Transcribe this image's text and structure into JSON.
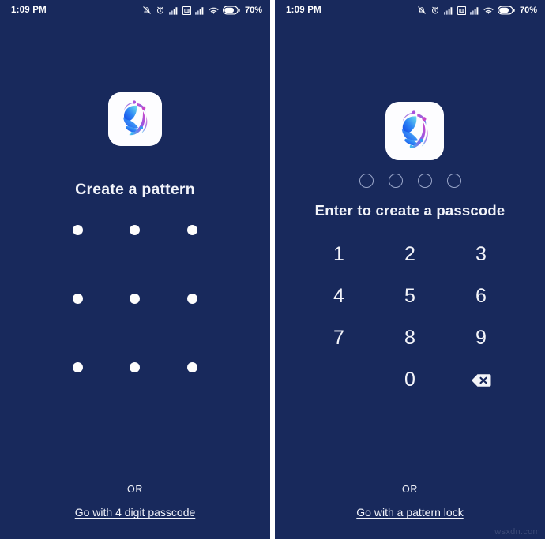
{
  "meta": {
    "watermark": "wsxdn.com",
    "background_color": "#18295c",
    "text_color": "#f2f4fa",
    "dot_color": "#fdfdfd"
  },
  "statusbar": {
    "time": "1:09 PM",
    "battery_percent": "70%",
    "icons": [
      "bell-muted-icon",
      "alarm-clock-icon",
      "signal-bars-icon",
      "sim-card-icon",
      "signal-bars-2-icon",
      "wifi-icon",
      "battery-icon"
    ]
  },
  "left_screen": {
    "app_logo_name": "app-logo",
    "title": "Create a pattern",
    "pattern_dots": [
      [
        "dot-1",
        "dot-2",
        "dot-3"
      ],
      [
        "dot-4",
        "dot-5",
        "dot-6"
      ],
      [
        "dot-7",
        "dot-8",
        "dot-9"
      ]
    ],
    "or_label": "OR",
    "alt_link": "Go with 4 digit passcode"
  },
  "right_screen": {
    "app_logo_name": "app-logo",
    "passcode_indicator_count": 4,
    "passcode_entered": 0,
    "title": "Enter to create a passcode",
    "keypad": [
      "1",
      "2",
      "3",
      "4",
      "5",
      "6",
      "7",
      "8",
      "9",
      "",
      "0",
      "backspace-icon"
    ],
    "or_label": "OR",
    "alt_link": "Go with a pattern lock"
  }
}
